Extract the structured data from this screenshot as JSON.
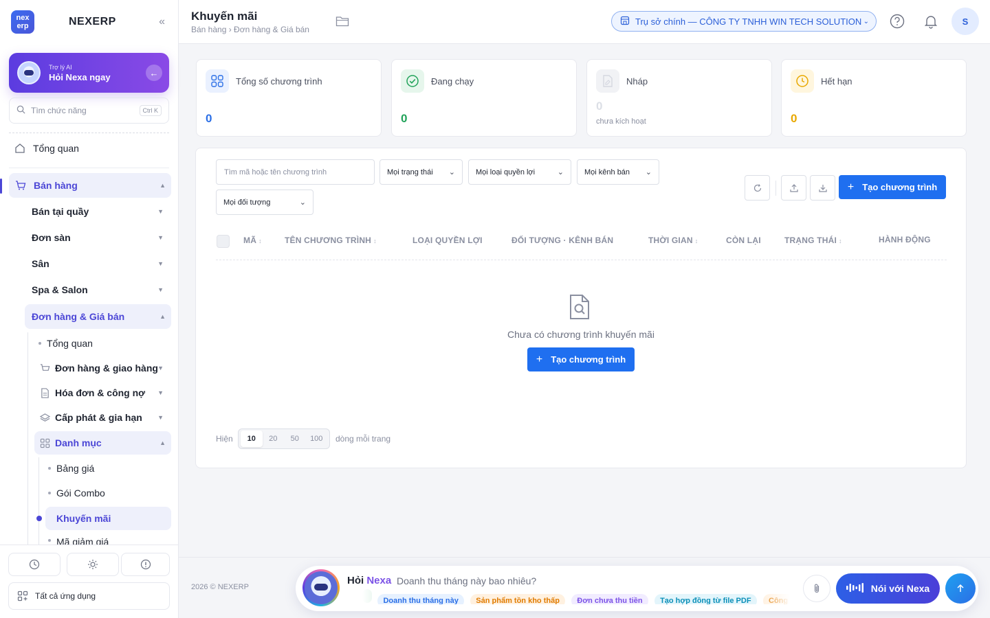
{
  "brand": {
    "logo_text": "nex erp",
    "name": "NEXERP"
  },
  "ai_assistant": {
    "small": "Trợ lý AI",
    "title": "Hỏi Nexa ngay"
  },
  "search": {
    "placeholder": "Tìm chức năng",
    "shortcut": "Ctrl K"
  },
  "sidebar": {
    "overview": "Tổng quan",
    "sales": "Bán hàng",
    "sales_children": [
      "Bán tại quầy",
      "Đơn sàn",
      "Sân",
      "Spa & Salon",
      "Đơn hàng & Giá bán"
    ],
    "orders_children": [
      "Tổng quan",
      "Đơn hàng & giao hàng",
      "Hóa đơn & công nợ",
      "Cấp phát & gia hạn",
      "Danh mục"
    ],
    "catalog_children": [
      "Bảng giá",
      "Gói Combo",
      "Khuyến mãi",
      "Mã giảm giá"
    ],
    "all_apps": "Tất cả ứng dụng"
  },
  "header": {
    "title": "Khuyến mãi",
    "breadcrumb": "Bán hàng › Đơn hàng & Giá bán",
    "branch": "Trụ sở chính — CÔNG TY TNHH WIN TECH SOLUTION",
    "avatar": "S"
  },
  "stats": [
    {
      "label": "Tổng số chương trình",
      "value": "0",
      "sub": ""
    },
    {
      "label": "Đang chạy",
      "value": "0",
      "sub": ""
    },
    {
      "label": "Nháp",
      "value": "0",
      "sub": "chưa kích hoạt"
    },
    {
      "label": "Hết hạn",
      "value": "0",
      "sub": ""
    }
  ],
  "filters": {
    "search_placeholder": "Tìm mã hoặc tên chương trình",
    "status": "Mọi trạng thái",
    "benefit": "Mọi loại quyền lợi",
    "channel": "Mọi kênh bán",
    "audience": "Mọi đối tượng",
    "create_button": "Tạo chương trình"
  },
  "table": {
    "headers": [
      "MÃ",
      "TÊN CHƯƠNG TRÌNH",
      "LOẠI QUYỀN LỢI",
      "ĐỐI TƯỢNG · KÊNH BÁN",
      "THỜI GIAN",
      "CÒN LẠI",
      "TRẠNG THÁI",
      "HÀNH ĐỘNG"
    ],
    "empty_text": "Chưa có chương trình khuyến mãi",
    "empty_button": "Tạo chương trình"
  },
  "pagination": {
    "prefix": "Hiện",
    "sizes": [
      "10",
      "20",
      "50",
      "100"
    ],
    "selected": "10",
    "suffix": "dòng mỗi trang"
  },
  "footer": {
    "copyright": "2026 © NEXERP",
    "ask_prefix": "Hỏi",
    "ask_brand": "Nexa",
    "question": "Doanh thu tháng này bao nhiêu?",
    "chips": [
      "Doanh thu tháng này",
      "Sản phẩm tồn kho thấp",
      "Đơn chưa thu tiền",
      "Tạo hợp đồng từ file PDF",
      "Công nợ quá hạn"
    ],
    "talk_button": "Nói với Nexa"
  },
  "colors": {
    "primary": "#1f6ff0",
    "accent": "#4b46d6",
    "success": "#22a35a",
    "warning": "#e8a800"
  }
}
